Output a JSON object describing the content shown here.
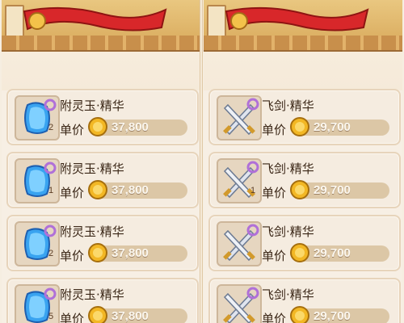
{
  "left_panel": {
    "items": [
      {
        "name": "附灵玉·精华",
        "quantity": "2",
        "price_label": "单价",
        "price": "37,800",
        "icon": "blue-jade-gem-icon"
      },
      {
        "name": "附灵玉·精华",
        "quantity": "1",
        "price_label": "单价",
        "price": "37,800",
        "icon": "blue-jade-gem-icon"
      },
      {
        "name": "附灵玉·精华",
        "quantity": "2",
        "price_label": "单价",
        "price": "37,800",
        "icon": "blue-jade-gem-icon"
      },
      {
        "name": "附灵玉·精华",
        "quantity": "5",
        "price_label": "单价",
        "price": "37,800",
        "icon": "blue-jade-gem-icon"
      }
    ]
  },
  "right_panel": {
    "items": [
      {
        "name": "飞剑·精华",
        "quantity": "",
        "price_label": "单价",
        "price": "29,700",
        "icon": "crossed-swords-icon"
      },
      {
        "name": "飞剑·精华",
        "quantity": "1",
        "price_label": "单价",
        "price": "29,700",
        "icon": "crossed-swords-icon"
      },
      {
        "name": "飞剑·精华",
        "quantity": "",
        "price_label": "单价",
        "price": "29,700",
        "icon": "crossed-swords-icon"
      },
      {
        "name": "飞剑·精华",
        "quantity": "",
        "price_label": "单价",
        "price": "29,700",
        "icon": "crossed-swords-icon"
      }
    ]
  },
  "colors": {
    "panel_bg": "#f7efe4",
    "row_bg": "#f5ece0",
    "price_bar": "#dcc7a6",
    "banner_red": "#d8272a",
    "coin_gold": "#f2b724"
  }
}
